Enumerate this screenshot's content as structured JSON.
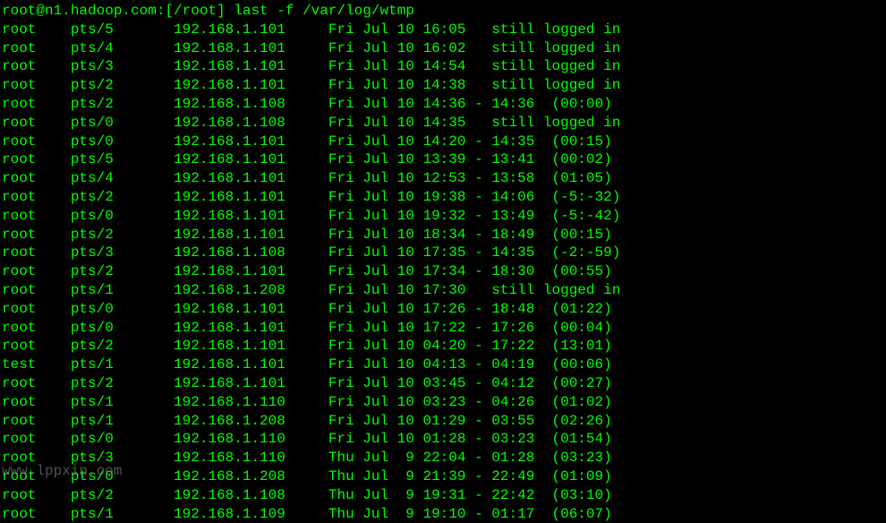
{
  "prompt": {
    "user_host": "root@n1.hadoop.com",
    "path": "/root",
    "command": "last -f /var/log/wtmp"
  },
  "entries": [
    {
      "user": "root",
      "tty": "pts/5",
      "from": "192.168.1.101",
      "day": "Fri",
      "mon": "Jul",
      "date": "10",
      "time": "16:05",
      "status": "  still logged in"
    },
    {
      "user": "root",
      "tty": "pts/4",
      "from": "192.168.1.101",
      "day": "Fri",
      "mon": "Jul",
      "date": "10",
      "time": "16:02",
      "status": "  still logged in"
    },
    {
      "user": "root",
      "tty": "pts/3",
      "from": "192.168.1.101",
      "day": "Fri",
      "mon": "Jul",
      "date": "10",
      "time": "14:54",
      "status": "  still logged in"
    },
    {
      "user": "root",
      "tty": "pts/2",
      "from": "192.168.1.101",
      "day": "Fri",
      "mon": "Jul",
      "date": "10",
      "time": "14:38",
      "status": "  still logged in"
    },
    {
      "user": "root",
      "tty": "pts/2",
      "from": "192.168.1.108",
      "day": "Fri",
      "mon": "Jul",
      "date": "10",
      "time": "14:36",
      "status": "- 14:36  (00:00)"
    },
    {
      "user": "root",
      "tty": "pts/0",
      "from": "192.168.1.108",
      "day": "Fri",
      "mon": "Jul",
      "date": "10",
      "time": "14:35",
      "status": "  still logged in"
    },
    {
      "user": "root",
      "tty": "pts/0",
      "from": "192.168.1.101",
      "day": "Fri",
      "mon": "Jul",
      "date": "10",
      "time": "14:20",
      "status": "- 14:35  (00:15)"
    },
    {
      "user": "root",
      "tty": "pts/5",
      "from": "192.168.1.101",
      "day": "Fri",
      "mon": "Jul",
      "date": "10",
      "time": "13:39",
      "status": "- 13:41  (00:02)"
    },
    {
      "user": "root",
      "tty": "pts/4",
      "from": "192.168.1.101",
      "day": "Fri",
      "mon": "Jul",
      "date": "10",
      "time": "12:53",
      "status": "- 13:58  (01:05)"
    },
    {
      "user": "root",
      "tty": "pts/2",
      "from": "192.168.1.101",
      "day": "Fri",
      "mon": "Jul",
      "date": "10",
      "time": "19:38",
      "status": "- 14:06  (-5:-32)"
    },
    {
      "user": "root",
      "tty": "pts/0",
      "from": "192.168.1.101",
      "day": "Fri",
      "mon": "Jul",
      "date": "10",
      "time": "19:32",
      "status": "- 13:49  (-5:-42)"
    },
    {
      "user": "root",
      "tty": "pts/2",
      "from": "192.168.1.101",
      "day": "Fri",
      "mon": "Jul",
      "date": "10",
      "time": "18:34",
      "status": "- 18:49  (00:15)"
    },
    {
      "user": "root",
      "tty": "pts/3",
      "from": "192.168.1.108",
      "day": "Fri",
      "mon": "Jul",
      "date": "10",
      "time": "17:35",
      "status": "- 14:35  (-2:-59)"
    },
    {
      "user": "root",
      "tty": "pts/2",
      "from": "192.168.1.101",
      "day": "Fri",
      "mon": "Jul",
      "date": "10",
      "time": "17:34",
      "status": "- 18:30  (00:55)"
    },
    {
      "user": "root",
      "tty": "pts/1",
      "from": "192.168.1.208",
      "day": "Fri",
      "mon": "Jul",
      "date": "10",
      "time": "17:30",
      "status": "  still logged in"
    },
    {
      "user": "root",
      "tty": "pts/0",
      "from": "192.168.1.101",
      "day": "Fri",
      "mon": "Jul",
      "date": "10",
      "time": "17:26",
      "status": "- 18:48  (01:22)"
    },
    {
      "user": "root",
      "tty": "pts/0",
      "from": "192.168.1.101",
      "day": "Fri",
      "mon": "Jul",
      "date": "10",
      "time": "17:22",
      "status": "- 17:26  (00:04)"
    },
    {
      "user": "root",
      "tty": "pts/2",
      "from": "192.168.1.101",
      "day": "Fri",
      "mon": "Jul",
      "date": "10",
      "time": "04:20",
      "status": "- 17:22  (13:01)"
    },
    {
      "user": "test",
      "tty": "pts/1",
      "from": "192.168.1.101",
      "day": "Fri",
      "mon": "Jul",
      "date": "10",
      "time": "04:13",
      "status": "- 04:19  (00:06)"
    },
    {
      "user": "root",
      "tty": "pts/2",
      "from": "192.168.1.101",
      "day": "Fri",
      "mon": "Jul",
      "date": "10",
      "time": "03:45",
      "status": "- 04:12  (00:27)"
    },
    {
      "user": "root",
      "tty": "pts/1",
      "from": "192.168.1.110",
      "day": "Fri",
      "mon": "Jul",
      "date": "10",
      "time": "03:23",
      "status": "- 04:26  (01:02)"
    },
    {
      "user": "root",
      "tty": "pts/1",
      "from": "192.168.1.208",
      "day": "Fri",
      "mon": "Jul",
      "date": "10",
      "time": "01:29",
      "status": "- 03:55  (02:26)"
    },
    {
      "user": "root",
      "tty": "pts/0",
      "from": "192.168.1.110",
      "day": "Fri",
      "mon": "Jul",
      "date": "10",
      "time": "01:28",
      "status": "- 03:23  (01:54)"
    },
    {
      "user": "root",
      "tty": "pts/3",
      "from": "192.168.1.110",
      "day": "Thu",
      "mon": "Jul",
      "date": " 9",
      "time": "22:04",
      "status": "- 01:28  (03:23)"
    },
    {
      "user": "root",
      "tty": "pts/0",
      "from": "192.168.1.208",
      "day": "Thu",
      "mon": "Jul",
      "date": " 9",
      "time": "21:39",
      "status": "- 22:49  (01:09)"
    },
    {
      "user": "root",
      "tty": "pts/2",
      "from": "192.168.1.108",
      "day": "Thu",
      "mon": "Jul",
      "date": " 9",
      "time": "19:31",
      "status": "- 22:42  (03:10)"
    },
    {
      "user": "root",
      "tty": "pts/1",
      "from": "192.168.1.109",
      "day": "Thu",
      "mon": "Jul",
      "date": " 9",
      "time": "19:10",
      "status": "- 01:17  (06:07)"
    }
  ],
  "watermark": "www.lppxin.com"
}
